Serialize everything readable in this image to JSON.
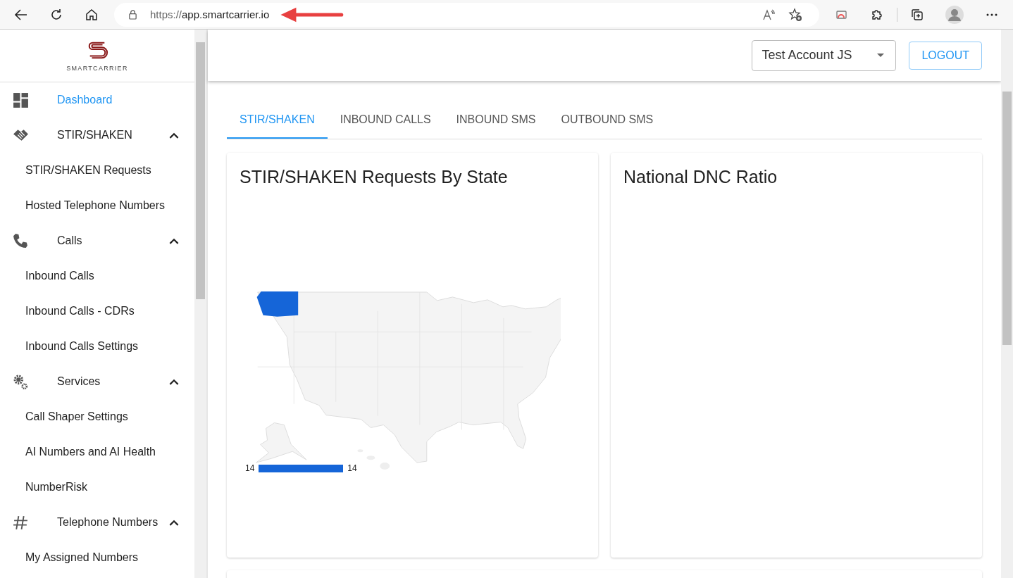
{
  "browser": {
    "url_scheme": "https://",
    "url_host": "app.smartcarrier.io"
  },
  "logo": {
    "text": "SMARTCARRIER"
  },
  "sidebar": {
    "items": [
      {
        "kind": "link",
        "label": "Dashboard",
        "selected": true
      },
      {
        "kind": "group",
        "label": "STIR/SHAKEN",
        "expanded": true,
        "children": [
          {
            "label": "STIR/SHAKEN Requests",
            "selected": false
          },
          {
            "label": "Hosted Telephone Numbers",
            "selected": false
          }
        ]
      },
      {
        "kind": "group",
        "label": "Calls",
        "expanded": true,
        "children": [
          {
            "label": "Inbound Calls",
            "selected": false
          },
          {
            "label": "Inbound Calls - CDRs",
            "selected": false
          },
          {
            "label": "Inbound Calls Settings",
            "selected": false
          }
        ]
      },
      {
        "kind": "group",
        "label": "Services",
        "expanded": true,
        "children": [
          {
            "label": "Call Shaper Settings",
            "selected": false
          },
          {
            "label": "AI Numbers and AI Health",
            "selected": false
          },
          {
            "label": "NumberRisk",
            "selected": false
          }
        ]
      },
      {
        "kind": "group",
        "label": "Telephone Numbers",
        "expanded": true,
        "children": [
          {
            "label": "My Assigned Numbers",
            "selected": false
          }
        ]
      }
    ]
  },
  "header": {
    "account": "Test Account JS",
    "logout": "LOGOUT"
  },
  "tabs": [
    {
      "label": "STIR/SHAKEN",
      "selected": true
    },
    {
      "label": "INBOUND CALLS",
      "selected": false
    },
    {
      "label": "INBOUND SMS",
      "selected": false
    },
    {
      "label": "OUTBOUND SMS",
      "selected": false
    }
  ],
  "cards": [
    {
      "kind": "map",
      "title": "STIR/SHAKEN Requests By State",
      "legend_min": "14",
      "legend_max": "14"
    },
    {
      "kind": "empty",
      "title": "National DNC Ratio"
    }
  ]
}
